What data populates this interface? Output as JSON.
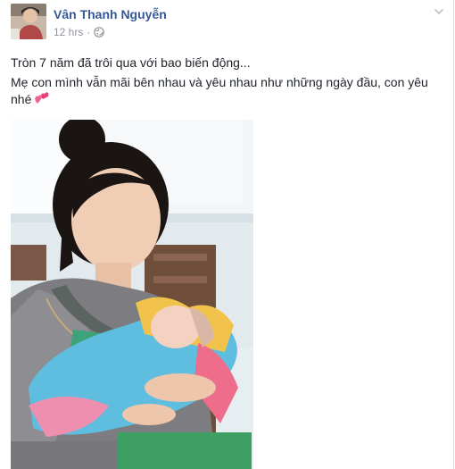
{
  "post": {
    "author": "Vân Thanh Nguyễn",
    "timestamp": "12 hrs",
    "separator": "·",
    "privacy_icon": "globe-icon",
    "menu_icon": "chevron-down-icon",
    "paragraphs": [
      "Tròn 7 năm đã trôi qua với bao biến động...",
      "Mẹ con mình vẫn mãi bên nhau và yêu nhau như những ngày đầu, con yêu nhé"
    ],
    "emoji": "two-hearts-icon",
    "photo_description_icon": "mother-holding-baby-photo",
    "colors": {
      "author": "#365899",
      "meta": "#90949c",
      "text": "#1d2129"
    }
  }
}
